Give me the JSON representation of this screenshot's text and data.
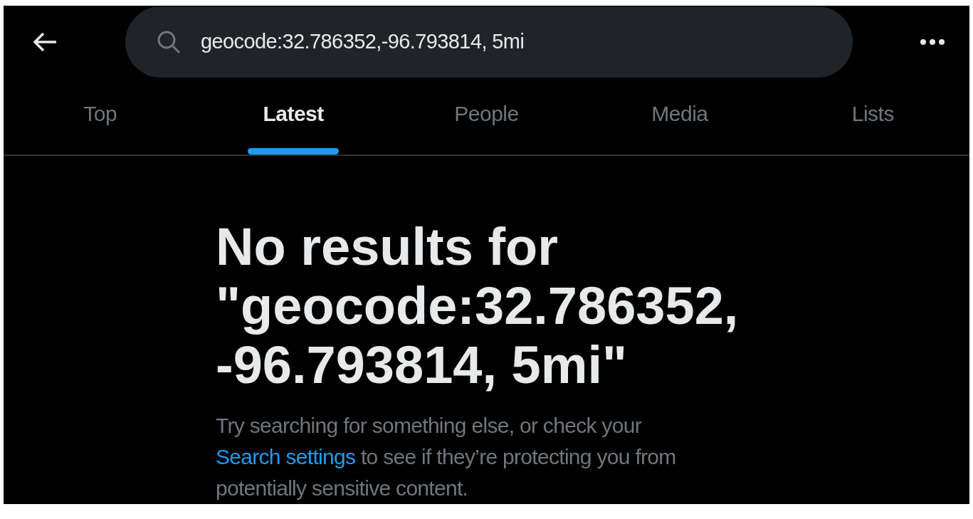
{
  "header": {
    "search": {
      "value": "geocode:32.786352,-96.793814, 5mi"
    }
  },
  "tabs": [
    {
      "label": "Top",
      "selected": false
    },
    {
      "label": "Latest",
      "selected": true
    },
    {
      "label": "People",
      "selected": false
    },
    {
      "label": "Media",
      "selected": false
    },
    {
      "label": "Lists",
      "selected": false
    }
  ],
  "empty_state": {
    "title": "No results for \"geocode:32.786352,-96.793814, 5mi\"",
    "message_before": "Try searching for something else, or check your",
    "link": "Search settings",
    "message_after": "to see if they’re protecting you from potentially sensitive content."
  }
}
